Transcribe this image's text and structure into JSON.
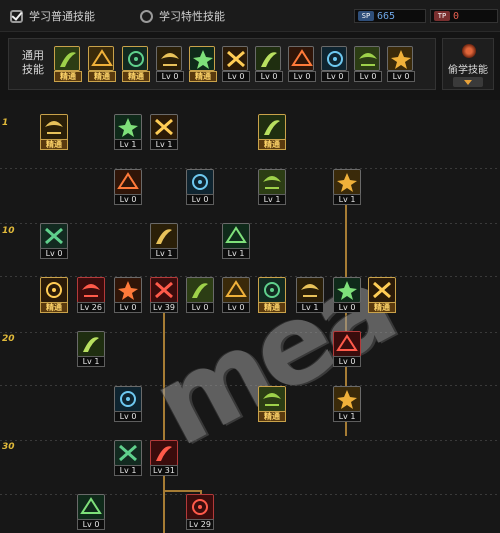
{
  "tabs": [
    {
      "label": "学习普通技能",
      "selected": true
    },
    {
      "label": "学习特性技能",
      "selected": false
    }
  ],
  "points": {
    "sp": {
      "icon": "sp",
      "value": "665"
    },
    "tp": {
      "icon": "tp",
      "value": "0"
    }
  },
  "common": {
    "label": "通用\n技能",
    "skills": [
      {
        "name": "common-skill-1",
        "label": "精通",
        "gold": true
      },
      {
        "name": "common-skill-2",
        "label": "精通",
        "gold": true
      },
      {
        "name": "common-skill-3",
        "label": "精通",
        "gold": true
      },
      {
        "name": "common-skill-4",
        "label": "Lv 0",
        "gold": false
      },
      {
        "name": "common-skill-5",
        "label": "精通",
        "gold": true
      },
      {
        "name": "common-skill-6",
        "label": "Lv 0",
        "gold": false
      },
      {
        "name": "common-skill-7",
        "label": "Lv 0",
        "gold": false
      },
      {
        "name": "common-skill-8",
        "label": "Lv 0",
        "gold": false
      },
      {
        "name": "common-skill-9",
        "label": "Lv 0",
        "gold": false
      },
      {
        "name": "common-skill-10",
        "label": "Lv 0",
        "gold": false
      },
      {
        "name": "common-skill-11",
        "label": "Lv 0",
        "gold": false
      }
    ]
  },
  "steal": {
    "label": "偷学技能"
  },
  "levels": [
    "1",
    "10",
    "20",
    "30"
  ],
  "tree": [
    {
      "label": "精通",
      "gold": true
    },
    {
      "label": "Lv 1"
    },
    {
      "label": "Lv 1"
    },
    {
      "label": "精通",
      "gold": true
    },
    {
      "label": "Lv 0"
    },
    {
      "label": "Lv 0"
    },
    {
      "label": "Lv 1"
    },
    {
      "label": "Lv 1"
    },
    {
      "label": "Lv 0"
    },
    {
      "label": "Lv 1"
    },
    {
      "label": "Lv 1"
    },
    {
      "label": "精通",
      "gold": true
    },
    {
      "label": "Lv 26",
      "red": true
    },
    {
      "label": "Lv 0"
    },
    {
      "label": "Lv 39",
      "red": true
    },
    {
      "label": "Lv 0"
    },
    {
      "label": "Lv 0"
    },
    {
      "label": "精通",
      "gold": true
    },
    {
      "label": "Lv 1"
    },
    {
      "label": "Lv 0"
    },
    {
      "label": "精通",
      "gold": true
    },
    {
      "label": "Lv 1"
    },
    {
      "label": "Lv 0",
      "red": true
    },
    {
      "label": "Lv 0"
    },
    {
      "label": "精通",
      "gold": true
    },
    {
      "label": "Lv 1"
    },
    {
      "label": "Lv 1"
    },
    {
      "label": "Lv 31",
      "red": true
    },
    {
      "label": "Lv 0"
    },
    {
      "label": "Lv 29",
      "red": true
    }
  ],
  "watermark": "mea"
}
